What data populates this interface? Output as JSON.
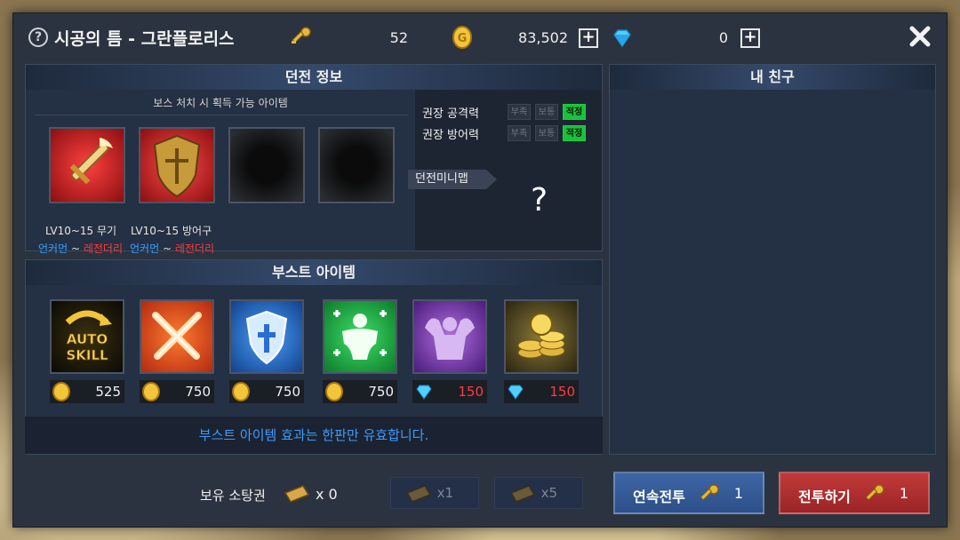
{
  "topbar": {
    "help": "?",
    "title": "시공의 틈 - 그란플로리스",
    "keys": "52",
    "gold": "83,502",
    "gems": "0",
    "plus": "+"
  },
  "dungeon_info": {
    "header": "던전 정보",
    "drop_caption": "보스 처치 시 획득 가능 아이템",
    "rewards": [
      {
        "label": "LV10~15 무기",
        "grade_from": "언커먼",
        "sep": "~",
        "grade_to": "레전더리"
      },
      {
        "label": "LV10~15 방어구",
        "grade_from": "언커먼",
        "sep": "~",
        "grade_to": "레전더리"
      }
    ],
    "stats": [
      {
        "label": "권장 공격력",
        "levels": [
          "부족",
          "보통",
          "적정"
        ],
        "active": 2
      },
      {
        "label": "권장 방어력",
        "levels": [
          "부족",
          "보통",
          "적정"
        ],
        "active": 2
      }
    ],
    "minimap_label": "던전미니맵",
    "minimap_unknown": "?"
  },
  "boost": {
    "header": "부스트 아이템",
    "items": [
      {
        "name": "auto-skill",
        "text": "AUTO SKILL",
        "currency": "gold",
        "price": "525"
      },
      {
        "name": "attack-boost",
        "currency": "gold",
        "price": "750"
      },
      {
        "name": "defense-boost",
        "currency": "gold",
        "price": "750"
      },
      {
        "name": "hp-boost",
        "currency": "gold",
        "price": "750"
      },
      {
        "name": "stat-boost",
        "currency": "gem",
        "price": "150"
      },
      {
        "name": "gold-boost",
        "currency": "gem",
        "price": "150"
      }
    ],
    "notice": "부스트 아이템 효과는 한판만 유효합니다."
  },
  "friends": {
    "header": "내 친구"
  },
  "bottom": {
    "owned_label": "보유 소탕권",
    "owned_count": "x 0",
    "sweep1": "x1",
    "sweep5": "x5",
    "continuous_label": "연속전투",
    "continuous_count": "1",
    "fight_label": "전투하기",
    "fight_count": "1"
  },
  "colors": {
    "panel": "#2b3340",
    "uncommon": "#3aa0ff",
    "legendary": "#ff3a3a",
    "active_chip": "#18c23a",
    "notice": "#3d9bff",
    "continuous_btn": "#3e66a6",
    "fight_btn": "#c23a3a"
  }
}
